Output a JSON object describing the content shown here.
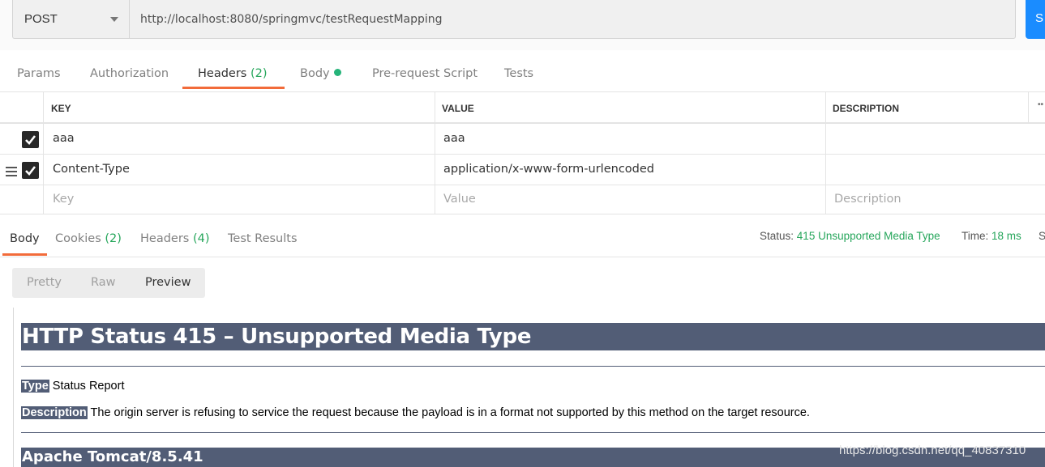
{
  "request": {
    "method": "POST",
    "url": "http://localhost:8080/springmvc/testRequestMapping",
    "send_label": "S"
  },
  "request_tabs": [
    {
      "label": "Params",
      "count": ""
    },
    {
      "label": "Authorization",
      "count": ""
    },
    {
      "label": "Headers",
      "count": "(2)"
    },
    {
      "label": "Body",
      "count": ""
    },
    {
      "label": "Pre-request Script",
      "count": ""
    },
    {
      "label": "Tests",
      "count": ""
    }
  ],
  "headers_table": {
    "columns": [
      "KEY",
      "VALUE",
      "DESCRIPTION"
    ],
    "more": "••",
    "rows": [
      {
        "key": "aaa",
        "value": "aaa",
        "description": "",
        "checked": true
      },
      {
        "key": "Content-Type",
        "value": "application/x-www-form-urlencoded",
        "description": "",
        "checked": true
      }
    ],
    "placeholder": {
      "key": "Key",
      "value": "Value",
      "description": "Description"
    }
  },
  "response_tabs": [
    {
      "label": "Body",
      "count": ""
    },
    {
      "label": "Cookies",
      "count": "(2)"
    },
    {
      "label": "Headers",
      "count": "(4)"
    },
    {
      "label": "Test Results",
      "count": ""
    }
  ],
  "response_meta": {
    "status_label": "Status:",
    "status_value": "415 Unsupported Media Type",
    "time_label": "Time:",
    "time_value": "18 ms",
    "size_label": "S"
  },
  "view_modes": [
    "Pretty",
    "Raw",
    "Preview"
  ],
  "preview": {
    "h1": "HTTP Status 415 – Unsupported Media Type",
    "type_label": "Type",
    "type_text": " Status Report",
    "desc_label": "Description",
    "desc_text": " The origin server is refusing to service the request because the payload is in a format not supported by this method on the target resource.",
    "footer": "Apache Tomcat/8.5.41"
  },
  "watermark": "https://blog.csdn.net/qq_40837310",
  "colors": {
    "accent_orange": "#f26b3a",
    "status_green": "#26a65b",
    "tomcat_header": "#525d76",
    "send_blue": "#1a8cff"
  }
}
